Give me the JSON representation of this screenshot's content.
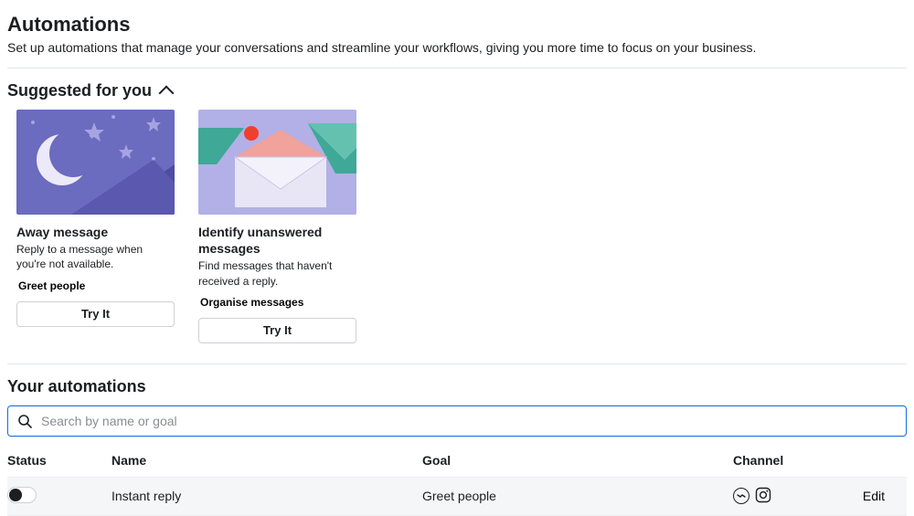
{
  "header": {
    "title": "Automations",
    "description": "Set up automations that manage your conversations and streamline your workflows, giving you more time to focus on your business."
  },
  "suggested": {
    "section_title": "Suggested for you",
    "try_label": "Try It",
    "cards": [
      {
        "title": "Away message",
        "description": "Reply to a message when you're not available.",
        "tag": "Greet people"
      },
      {
        "title": "Identify unanswered messages",
        "description": "Find messages that haven't received a reply.",
        "tag": "Organise messages"
      }
    ]
  },
  "your_automations": {
    "section_title": "Your automations",
    "search_placeholder": "Search by name or goal",
    "columns": {
      "status": "Status",
      "name": "Name",
      "goal": "Goal",
      "channel": "Channel"
    },
    "rows": [
      {
        "status_on": false,
        "name": "Instant reply",
        "goal": "Greet people",
        "channels": [
          "messenger",
          "instagram"
        ],
        "edit_label": "Edit"
      }
    ]
  }
}
